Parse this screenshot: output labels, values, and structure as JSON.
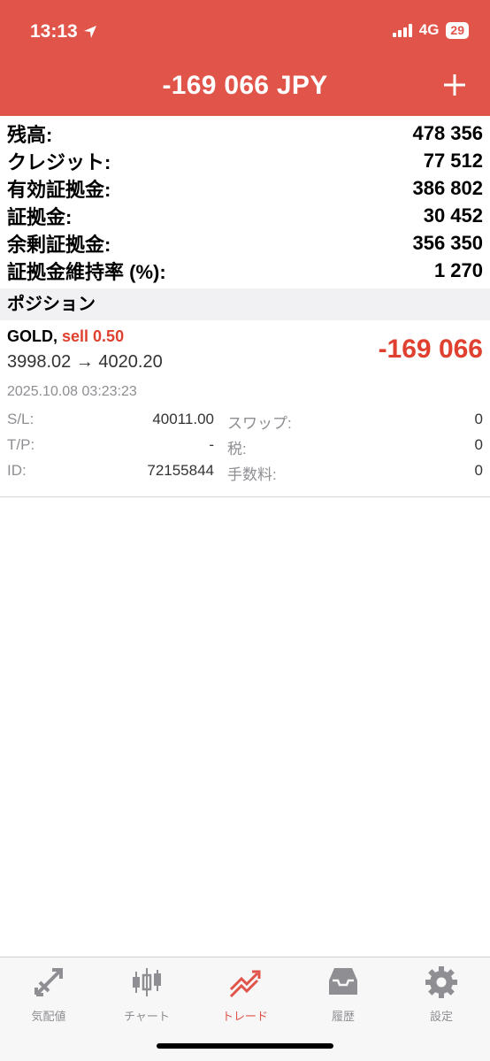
{
  "status_bar": {
    "time": "13:13",
    "network": "4G",
    "battery": "29"
  },
  "header": {
    "title": "-169 066 JPY"
  },
  "account": [
    {
      "label": "残高:",
      "value": "478 356"
    },
    {
      "label": "クレジット:",
      "value": "77 512"
    },
    {
      "label": "有効証拠金:",
      "value": "386 802"
    },
    {
      "label": "証拠金:",
      "value": "30 452"
    },
    {
      "label": "余剰証拠金:",
      "value": "356 350"
    },
    {
      "label": "証拠金維持率 (%):",
      "value": "1 270"
    }
  ],
  "section_title": "ポジション",
  "position": {
    "symbol": "GOLD,",
    "side": "sell 0.50",
    "prices": "3998.02 → 4020.20",
    "profit": "-169 066",
    "datetime": "2025.10.08 03:23:23",
    "details": [
      {
        "left_label": "S/L:",
        "left_value": "40011.00",
        "right_label": "スワップ:",
        "right_value": "0"
      },
      {
        "left_label": "T/P:",
        "left_value": "-",
        "right_label": "税:",
        "right_value": "0"
      },
      {
        "left_label": "ID:",
        "left_value": "72155844",
        "right_label": "手数料:",
        "right_value": "0"
      }
    ]
  },
  "tabs": [
    {
      "label": "気配値",
      "icon": "quotes-icon",
      "active": false
    },
    {
      "label": "チャート",
      "icon": "chart-icon",
      "active": false
    },
    {
      "label": "トレード",
      "icon": "trade-icon",
      "active": true
    },
    {
      "label": "履歴",
      "icon": "history-icon",
      "active": false
    },
    {
      "label": "設定",
      "icon": "settings-icon",
      "active": false
    }
  ],
  "colors": {
    "header": "#e0544a",
    "loss": "#e0402f",
    "muted": "#8e8e93"
  }
}
